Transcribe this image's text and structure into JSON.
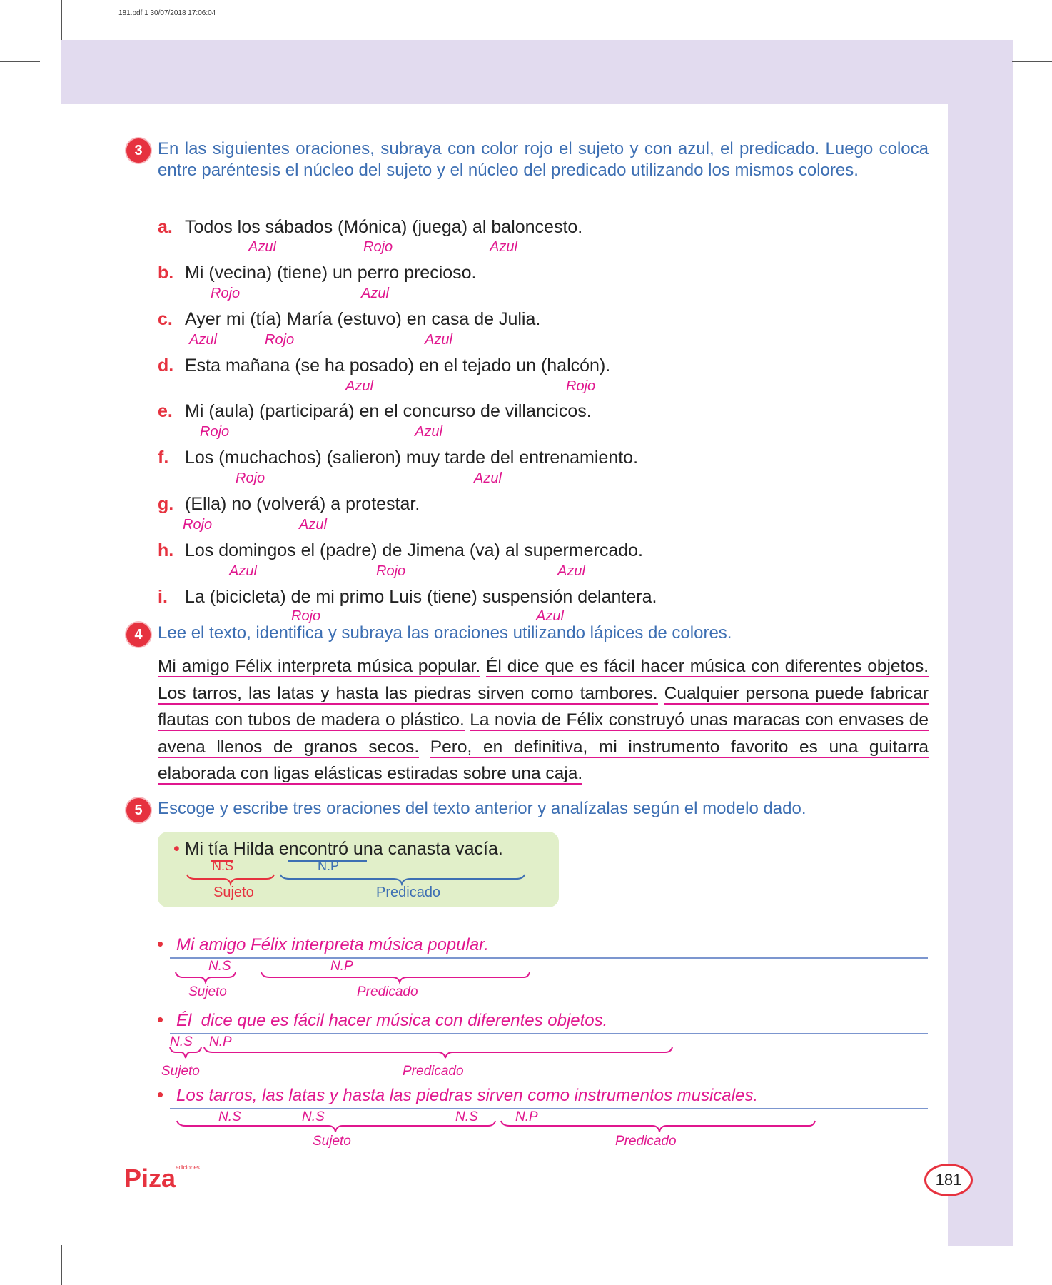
{
  "header": {
    "pdf_info": "181.pdf  1  30/07/2018  17:06:04"
  },
  "ex3": {
    "number": "3",
    "instruction": "En las siguientes oraciones, subraya con color rojo el sujeto y con azul, el predicado. Luego coloca entre paréntesis el núcleo del sujeto y el núcleo del predicado utilizando los mismos colores.",
    "items": [
      {
        "letter": "a.",
        "text": "Todos los sábados (Mónica) (juega) al baloncesto.",
        "labels": [
          "Azul",
          "Rojo",
          "Azul"
        ]
      },
      {
        "letter": "b.",
        "text": "Mi (vecina) (tiene) un perro precioso.",
        "labels": [
          "Rojo",
          "Azul"
        ]
      },
      {
        "letter": "c.",
        "text": "Ayer mi (tía) María (estuvo) en casa de Julia.",
        "labels": [
          "Azul",
          "Rojo",
          "Azul"
        ]
      },
      {
        "letter": "d.",
        "text": "Esta mañana (se ha posado) en el tejado un (halcón).",
        "labels": [
          "Azul",
          "Rojo"
        ]
      },
      {
        "letter": "e.",
        "text": "Mi (aula) (participará) en el concurso de villancicos.",
        "labels": [
          "Rojo",
          "Azul"
        ]
      },
      {
        "letter": "f.",
        "text": "Los (muchachos) (salieron) muy tarde del entrenamiento.",
        "labels": [
          "Rojo",
          "Azul"
        ]
      },
      {
        "letter": "g.",
        "text": "(Ella) no (volverá) a protestar.",
        "labels": [
          "Rojo",
          "Azul"
        ]
      },
      {
        "letter": "h.",
        "text": "Los domingos el (padre) de Jimena (va) al supermercado.",
        "labels": [
          "Azul",
          "Rojo",
          "Azul"
        ]
      },
      {
        "letter": "i.",
        "text": "La (bicicleta) de mi primo Luis (tiene) suspensión delantera.",
        "labels": [
          "Rojo",
          "Azul"
        ]
      }
    ]
  },
  "ex4": {
    "number": "4",
    "instruction": "Lee el texto, identifica y subraya las oraciones utilizando lápices de colores.",
    "sentences": [
      "Mi amigo Félix interpreta música popular.",
      "Él dice que es fácil hacer música con diferentes objetos.",
      "Los tarros, las latas y hasta las piedras sirven como tambores.",
      "Cualquier persona puede fabricar flautas con tubos de madera o plástico.",
      "La novia de Félix construyó unas maracas con envases de avena llenos de granos secos.",
      "Pero, en definitiva, mi instrumento favorito es una guitarra elaborada con ligas elásticas estiradas sobre una caja."
    ]
  },
  "ex5": {
    "number": "5",
    "instruction": "Escoge y escribe tres oraciones del texto anterior y analízalas según el modelo dado.",
    "model": {
      "sentence": "Mi tía Hilda encontró una canasta vacía.",
      "ns": "N.S",
      "np": "N.P",
      "subject": "Sujeto",
      "predicate": "Predicado"
    },
    "answers": [
      {
        "sentence": "Mi amigo Félix interpreta música popular.",
        "ns": "N.S",
        "np": "N.P",
        "subject": "Sujeto",
        "predicate": "Predicado"
      },
      {
        "sentence": "Él  dice que es fácil hacer música con diferentes objetos.",
        "ns": "N.S",
        "np": "N.P",
        "subject": "Sujeto",
        "predicate": "Predicado"
      },
      {
        "sentence": "Los tarros, las latas y hasta las piedras sirven como instrumentos musicales.",
        "ns": "N.S",
        "ns2": "N.S",
        "ns3": "N.S",
        "np": "N.P",
        "subject": "Sujeto",
        "predicate": "Predicado"
      }
    ]
  },
  "footer": {
    "logo": "Piza",
    "logo_small": "ediciones",
    "page": "181"
  },
  "colors": {
    "red": "#e6323f",
    "magenta": "#e0178e",
    "blue_text": "#3d6fb3",
    "lavender": "#e2dbef",
    "green_box": "#e1efc9"
  }
}
